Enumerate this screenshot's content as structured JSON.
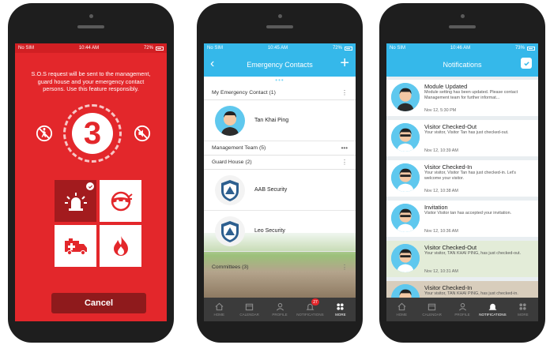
{
  "colors": {
    "sos_red": "#e3272b",
    "dark_red": "#8f1a1c",
    "brand_blue": "#35b8ea",
    "tab_bar": "#3b3b3b"
  },
  "phone1": {
    "status": {
      "carrier": "No SIM",
      "time": "10:44 AM",
      "battery": "72%"
    },
    "message": "S.O.S request will be sent to the management, guard house and your emergency contact persons. Use this feature responsibly.",
    "countdown": "3",
    "left_icon": "no-walking-icon",
    "right_icon": "mute-icon",
    "tiles": [
      {
        "name": "alarm-siren-icon",
        "selected": true
      },
      {
        "name": "burglar-icon",
        "selected": false
      },
      {
        "name": "ambulance-icon",
        "selected": false
      },
      {
        "name": "fire-icon",
        "selected": false
      }
    ],
    "cancel_label": "Cancel"
  },
  "phone2": {
    "status": {
      "carrier": "No SIM",
      "time": "10:45 AM",
      "battery": "72%"
    },
    "title": "Emergency Contacts",
    "back_icon": "back-chevron-icon",
    "add_icon": "plus-icon",
    "sections": {
      "my_emergency": "My Emergency Contact (1)",
      "management": "Management Team (5)",
      "guard_house": "Guard House (2)",
      "committees": "Committees (3)"
    },
    "contacts": {
      "personal": "Tan Khai Ping",
      "guard1": "AAB Security",
      "guard2": "Leo Security"
    },
    "tabs": [
      {
        "label": "HOME",
        "icon": "home-icon"
      },
      {
        "label": "CALENDAR",
        "icon": "calendar-icon"
      },
      {
        "label": "PROFILE",
        "icon": "profile-icon"
      },
      {
        "label": "NOTIFICATIONS",
        "icon": "bell-icon",
        "badge": "27"
      },
      {
        "label": "MORE",
        "icon": "more-grid-icon"
      }
    ]
  },
  "phone3": {
    "status": {
      "carrier": "No SIM",
      "time": "10:46 AM",
      "battery": "73%"
    },
    "title": "Notifications",
    "notifications": [
      {
        "title": "Module Updated",
        "body": "Module setting has been updated. Please contact Management team for further informat...",
        "time": "Nov 12, 5:30 PM"
      },
      {
        "title": "Visitor Checked-Out",
        "body": "Your visitor, Visitor Tan has just checked-out.",
        "time": "Nov 12, 10:39 AM"
      },
      {
        "title": "Visitor Checked-In",
        "body": "Your visitor, Visitor Tan has just checked-in. Let's welcome your visitor.",
        "time": "Nov 12, 10:38 AM"
      },
      {
        "title": "Invitation",
        "body": "Visitor Visitor tan has accepted your invitation.",
        "time": "Nov 12, 10:36 AM"
      },
      {
        "title": "Visitor Checked-Out",
        "body": "Your visitor, TAN KHAI PING, has just checked-out.",
        "time": "Nov 12, 10:31 AM"
      },
      {
        "title": "Visitor Checked-In",
        "body": "Your visitor, TAN KHAI PING, has just checked-in.",
        "time": ""
      }
    ],
    "tabs": [
      {
        "label": "HOME",
        "icon": "home-icon"
      },
      {
        "label": "CALENDAR",
        "icon": "calendar-icon"
      },
      {
        "label": "PROFILE",
        "icon": "profile-icon"
      },
      {
        "label": "NOTIFICATIONS",
        "icon": "bell-icon"
      },
      {
        "label": "MORE",
        "icon": "more-grid-icon"
      }
    ]
  }
}
